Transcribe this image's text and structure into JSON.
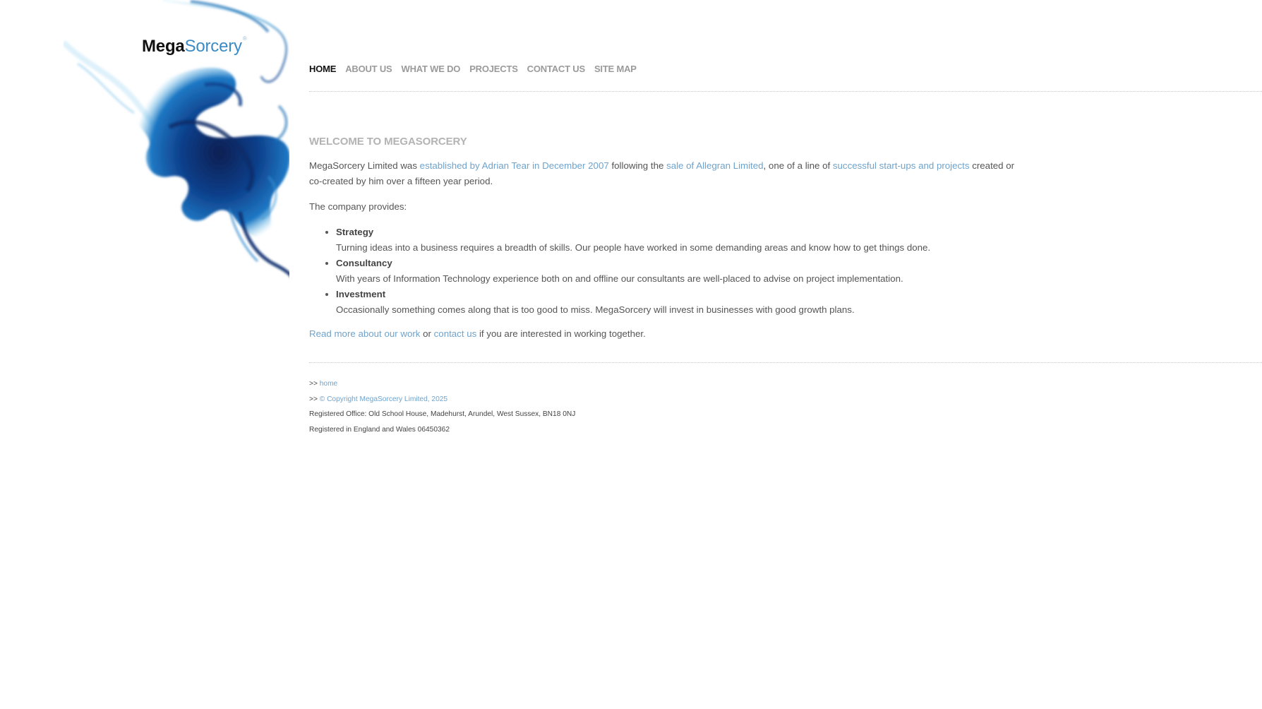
{
  "brand": {
    "name_bold": "Mega",
    "name_light": "Sorcery",
    "registered_mark": "®",
    "colors": {
      "text": "#111111",
      "accent": "#3b8bc5",
      "link": "#6fa3cc",
      "nav_inactive": "#9a9a9a",
      "heading": "#b3b3b3"
    }
  },
  "nav": {
    "items": [
      {
        "label": "HOME",
        "active": true
      },
      {
        "label": "ABOUT US",
        "active": false
      },
      {
        "label": "WHAT WE DO",
        "active": false
      },
      {
        "label": "PROJECTS",
        "active": false
      },
      {
        "label": "CONTACT US",
        "active": false
      },
      {
        "label": "SITE MAP",
        "active": false
      }
    ]
  },
  "main": {
    "heading": "WELCOME TO MEGASORCERY",
    "intro": {
      "t1": "MegaSorcery Limited was ",
      "link1": "established by Adrian Tear in December 2007",
      "t2": " following the ",
      "link2": "sale of Allegran Limited",
      "t3": ", one of a line of ",
      "link3": "successful start-ups and projects",
      "t4": " created or co-created by him over a fifteen year period."
    },
    "provides": "The company provides:",
    "services": [
      {
        "name": "Strategy",
        "desc": "Turning ideas into a business requires a breadth of skills. Our people have worked in some demanding areas and know how to get things done."
      },
      {
        "name": "Consultancy",
        "desc": "With years of Information Technology experience both on and offline our consultants are well-placed to advise on project implementation."
      },
      {
        "name": "Investment",
        "desc": "Occasionally something comes along that is too good to miss. MegaSorcery will invest in businesses with good growth plans."
      }
    ],
    "cta": {
      "link1": "Read more about our work",
      "t1": " or ",
      "link2": "contact us",
      "t2": " if you are interested in working together."
    }
  },
  "footer": {
    "prefix": ">> ",
    "home_link": "home",
    "copyright_link": "© Copyright MegaSorcery Limited, 2025",
    "registered_office": "Registered Office: Old School House, Madehurst, Arundel, West Sussex, BN18 0NJ",
    "registration": "Registered in England and Wales 06450362"
  }
}
